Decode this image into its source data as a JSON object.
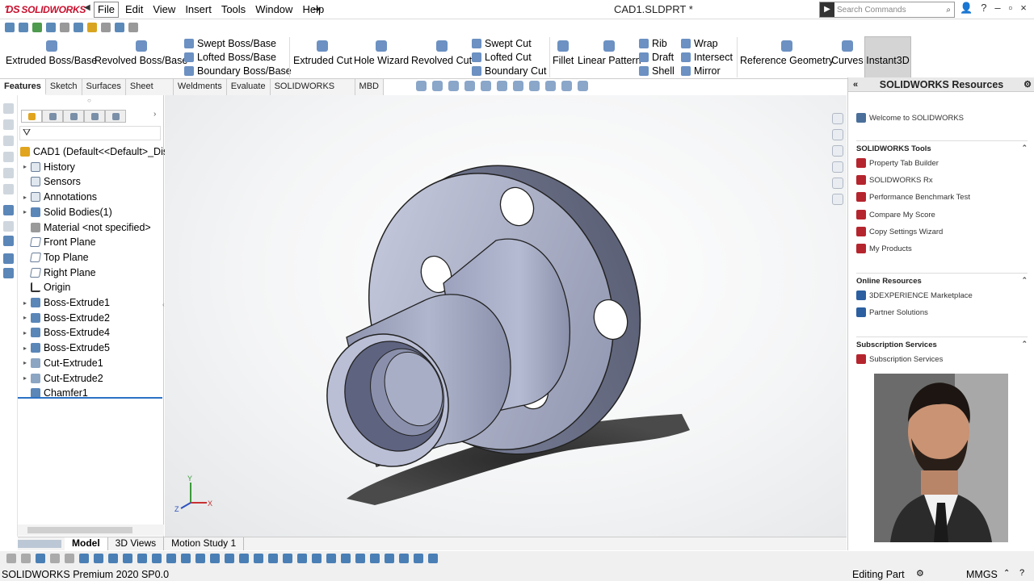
{
  "app": {
    "title": "CAD1.SLDPRT *",
    "logo_text": "SOLIDWORKS"
  },
  "menu": [
    "File",
    "Edit",
    "View",
    "Insert",
    "Tools",
    "Window",
    "Help"
  ],
  "search": {
    "placeholder": "Search Commands"
  },
  "window_controls": {
    "help": "?",
    "minimize": "–",
    "restore": "▫",
    "close": "×"
  },
  "command_manager": {
    "extruded_boss": "Extruded Boss/Base",
    "revolved_boss": "Revolved Boss/Base",
    "swept_boss": "Swept Boss/Base",
    "lofted_boss": "Lofted Boss/Base",
    "boundary_boss": "Boundary Boss/Base",
    "extruded_cut": "Extruded Cut",
    "hole_wizard": "Hole Wizard",
    "revolved_cut": "Revolved Cut",
    "swept_cut": "Swept Cut",
    "lofted_cut": "Lofted Cut",
    "boundary_cut": "Boundary Cut",
    "fillet": "Fillet",
    "linear_pattern": "Linear Pattern",
    "rib": "Rib",
    "draft": "Draft",
    "shell": "Shell",
    "wrap": "Wrap",
    "intersect": "Intersect",
    "mirror": "Mirror",
    "reference_geometry": "Reference Geometry",
    "curves": "Curves",
    "instant3d": "Instant3D"
  },
  "tabs": [
    "Features",
    "Sketch",
    "Surfaces",
    "Sheet Metal",
    "Weldments",
    "Evaluate",
    "SOLIDWORKS Add-Ins",
    "MBD"
  ],
  "feature_tree": {
    "root": "CAD1  (Default<<Default>_Dis",
    "items": [
      {
        "label": "History",
        "icon": "history-icon",
        "expandable": true
      },
      {
        "label": "Sensors",
        "icon": "sensors-icon",
        "expandable": false
      },
      {
        "label": "Annotations",
        "icon": "annotations-icon",
        "expandable": true
      },
      {
        "label": "Solid Bodies(1)",
        "icon": "solid-bodies-icon",
        "expandable": true
      },
      {
        "label": "Material <not specified>",
        "icon": "material-icon",
        "expandable": false
      },
      {
        "label": "Front Plane",
        "icon": "plane-icon",
        "expandable": false
      },
      {
        "label": "Top Plane",
        "icon": "plane-icon",
        "expandable": false
      },
      {
        "label": "Right Plane",
        "icon": "plane-icon",
        "expandable": false
      },
      {
        "label": "Origin",
        "icon": "origin-icon",
        "expandable": false
      },
      {
        "label": "Boss-Extrude1",
        "icon": "extrude-icon",
        "expandable": true
      },
      {
        "label": "Boss-Extrude2",
        "icon": "extrude-icon",
        "expandable": true
      },
      {
        "label": "Boss-Extrude4",
        "icon": "extrude-icon",
        "expandable": true
      },
      {
        "label": "Boss-Extrude5",
        "icon": "extrude-icon",
        "expandable": true
      },
      {
        "label": "Cut-Extrude1",
        "icon": "cut-icon",
        "expandable": true
      },
      {
        "label": "Cut-Extrude2",
        "icon": "cut-icon",
        "expandable": true
      },
      {
        "label": "Chamfer1",
        "icon": "chamfer-icon",
        "expandable": false
      }
    ]
  },
  "bottom_tabs": [
    "Model",
    "3D Views",
    "Motion Study 1"
  ],
  "triad": {
    "x": "X",
    "y": "Y",
    "z": "Z"
  },
  "task_pane": {
    "title": "SOLIDWORKS Resources",
    "welcome": "Welcome to SOLIDWORKS",
    "tools_header": "SOLIDWORKS Tools",
    "tools": [
      "Property Tab Builder",
      "SOLIDWORKS Rx",
      "Performance Benchmark Test",
      "Compare My Score",
      "Copy Settings Wizard",
      "My Products"
    ],
    "online_header": "Online Resources",
    "online": [
      "3DEXPERIENCE Marketplace",
      "Partner Solutions"
    ],
    "subscription_header": "Subscription Services",
    "subscription": [
      "Subscription Services"
    ]
  },
  "status": {
    "version": "SOLIDWORKS Premium 2020 SP0.0",
    "mode": "Editing Part",
    "units": "MMGS"
  },
  "colors": {
    "accent": "#2b72c4",
    "model": "#a8aec6",
    "brand": "#c8102e"
  }
}
